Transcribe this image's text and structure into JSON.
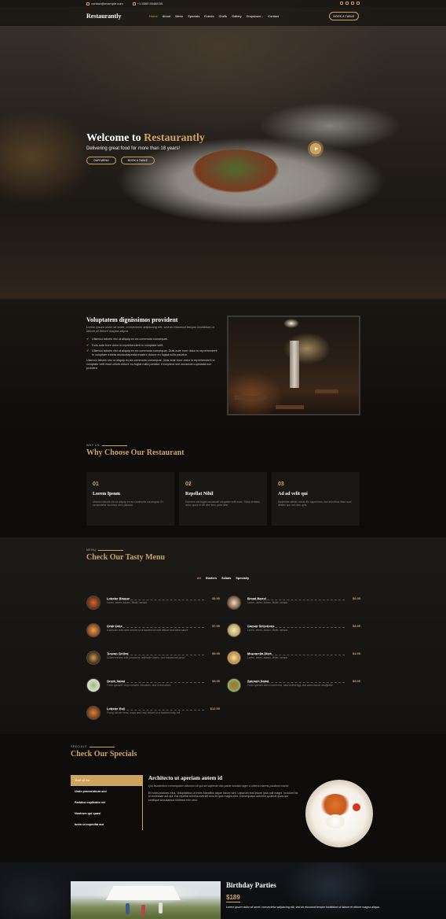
{
  "topbar": {
    "email": "contact@example.com",
    "phone": "+1 5589 55488 55",
    "social": [
      "twitter-icon",
      "facebook-icon",
      "instagram-icon",
      "linkedin-icon"
    ]
  },
  "header": {
    "logo": "Restaurantly",
    "nav": [
      "Home",
      "About",
      "Menu",
      "Specials",
      "Events",
      "Chefs",
      "Gallery",
      "Dropdown",
      "Contact"
    ],
    "active_nav": "Home",
    "cta": "BOOK A TABLE"
  },
  "hero": {
    "title_prefix": "Welcome to ",
    "title_brand": "Restaurantly",
    "subtitle": "Delivering great food for more than 18 years!",
    "btn_menu": "OUR MENU",
    "btn_book": "BOOK A TABLE"
  },
  "about": {
    "title": "Voluptatem dignissimos provident",
    "lead": "Lorem ipsum dolor sit amet, consectetur adipiscing elit, sed do eiusmod tempor incididunt ut labore et dolore magna aliqua.",
    "bullets": [
      "Ullamco laboris nisi ut aliquip ex ea commodo consequat.",
      "Duis aute irure dolor in reprehenderit in voluptate velit.",
      "Ullamco laboris nisi ut aliquip ex ea commodo consequat. Duis aute irure dolor in reprehenderit in voluptate trideta storacalaperda mastiro dolore eu fugiat nulla pariatur."
    ],
    "body": "Ullamco laboris nisi ut aliquip ex ea commodo consequat. Duis aute irure dolor in reprehenderit in voluptate velit esse cillum dolore eu fugiat nulla pariatur. Excepteur sint occaecat cupidatat non proident"
  },
  "why": {
    "tag": "WHY US",
    "title": "Why Choose Our Restaurant",
    "boxes": [
      {
        "num": "01",
        "title": "Lorem Ipsum",
        "desc": "Ulamco laboris nisi ut aliquip ex ea commodo consequat. Et consectetur ducimus vero placeat"
      },
      {
        "num": "02",
        "title": "Repellat Nihil",
        "desc": "Dolorem est fugiat occaecati voluptate velit esse. Dicta veritatis dolor quod et vel dire leno para dest"
      },
      {
        "num": "03",
        "title": "Ad ad velit qui",
        "desc": "Molestiae officiis omnis illo asperiores. Aut doloribus vitae sunt debitis quo vel nam quis"
      }
    ]
  },
  "menu": {
    "tag": "MENU",
    "title": "Check Our Tasty Menu",
    "filters": [
      "All",
      "Starters",
      "Salads",
      "Specialty"
    ],
    "active_filter": "All",
    "items": [
      {
        "name": "Lobster Bisque",
        "price": "$5.95",
        "desc": "Lorem, deren, trataro, filede, nerada"
      },
      {
        "name": "Bread Barrel",
        "price": "$6.95",
        "desc": "Lorem, deren, trataro, filede, nerada"
      },
      {
        "name": "Crab Cake",
        "price": "$7.95",
        "desc": "A delicate crab cake served on a toasted roll with lettuce and tartar sauce"
      },
      {
        "name": "Caesar Selections",
        "price": "$8.95",
        "desc": "Lorem, deren, trataro, filede, nerada"
      },
      {
        "name": "Tuscan Grilled",
        "price": "$9.95",
        "desc": "Grilled chicken with provolone, artichoke hearts, and roasted red pesto"
      },
      {
        "name": "Mozzarella Stick",
        "price": "$4.95",
        "desc": "Lorem, deren, trataro, filede, nerada"
      },
      {
        "name": "Greek Salad",
        "price": "$9.95",
        "desc": "Fresh spinach, crisp romaine, tomatoes, and Greek olives"
      },
      {
        "name": "Spinach Salad",
        "price": "$9.95",
        "desc": "Fresh spinach with mushrooms, hard boiled egg, and warm bacon vinaigrette"
      },
      {
        "name": "Lobster Roll",
        "price": "$12.95",
        "desc": "Plump lobster meat, mayo and crisp lettuce on a toasted bulky roll"
      }
    ]
  },
  "specials": {
    "tag": "SPECIALS",
    "title": "Check Our Specials",
    "tabs": [
      "Modi sit est",
      "Unde praesentium sed",
      "Pariatur explicabo vel",
      "Nostrum qui quasi",
      "Iusto ut expedita aut"
    ],
    "active_tab": "Modi sit est",
    "detail_title": "Architecto ut aperiam autem id",
    "detail_italic": "Qui laudantium consequatur laborum sit qui ad sapiente dila parde sonata raqer a videna mareta paulona marka",
    "detail_body": "Et nobis maiores eius. Voluptatibus ut enim blanditiis atque harum sint. Laborum eos ipsum ipsa odit magni. Incidunt hic ut molestiae aut qui. Est repellat minima eveniet eius et quis magni nihil. Consequatur dolorem quaerat quos qui similique accusamus nostrum rem vero"
  },
  "events": {
    "title": "Birthday Parties",
    "price": "$189",
    "desc": "Lorem ipsum dolor sit amet, consectetur adipiscing elit, sed do eiusmod tempor incididunt ut labore et dolore magna aliqua."
  },
  "colors": {
    "accent": "#cda45e",
    "bg": "#0c0b09"
  }
}
